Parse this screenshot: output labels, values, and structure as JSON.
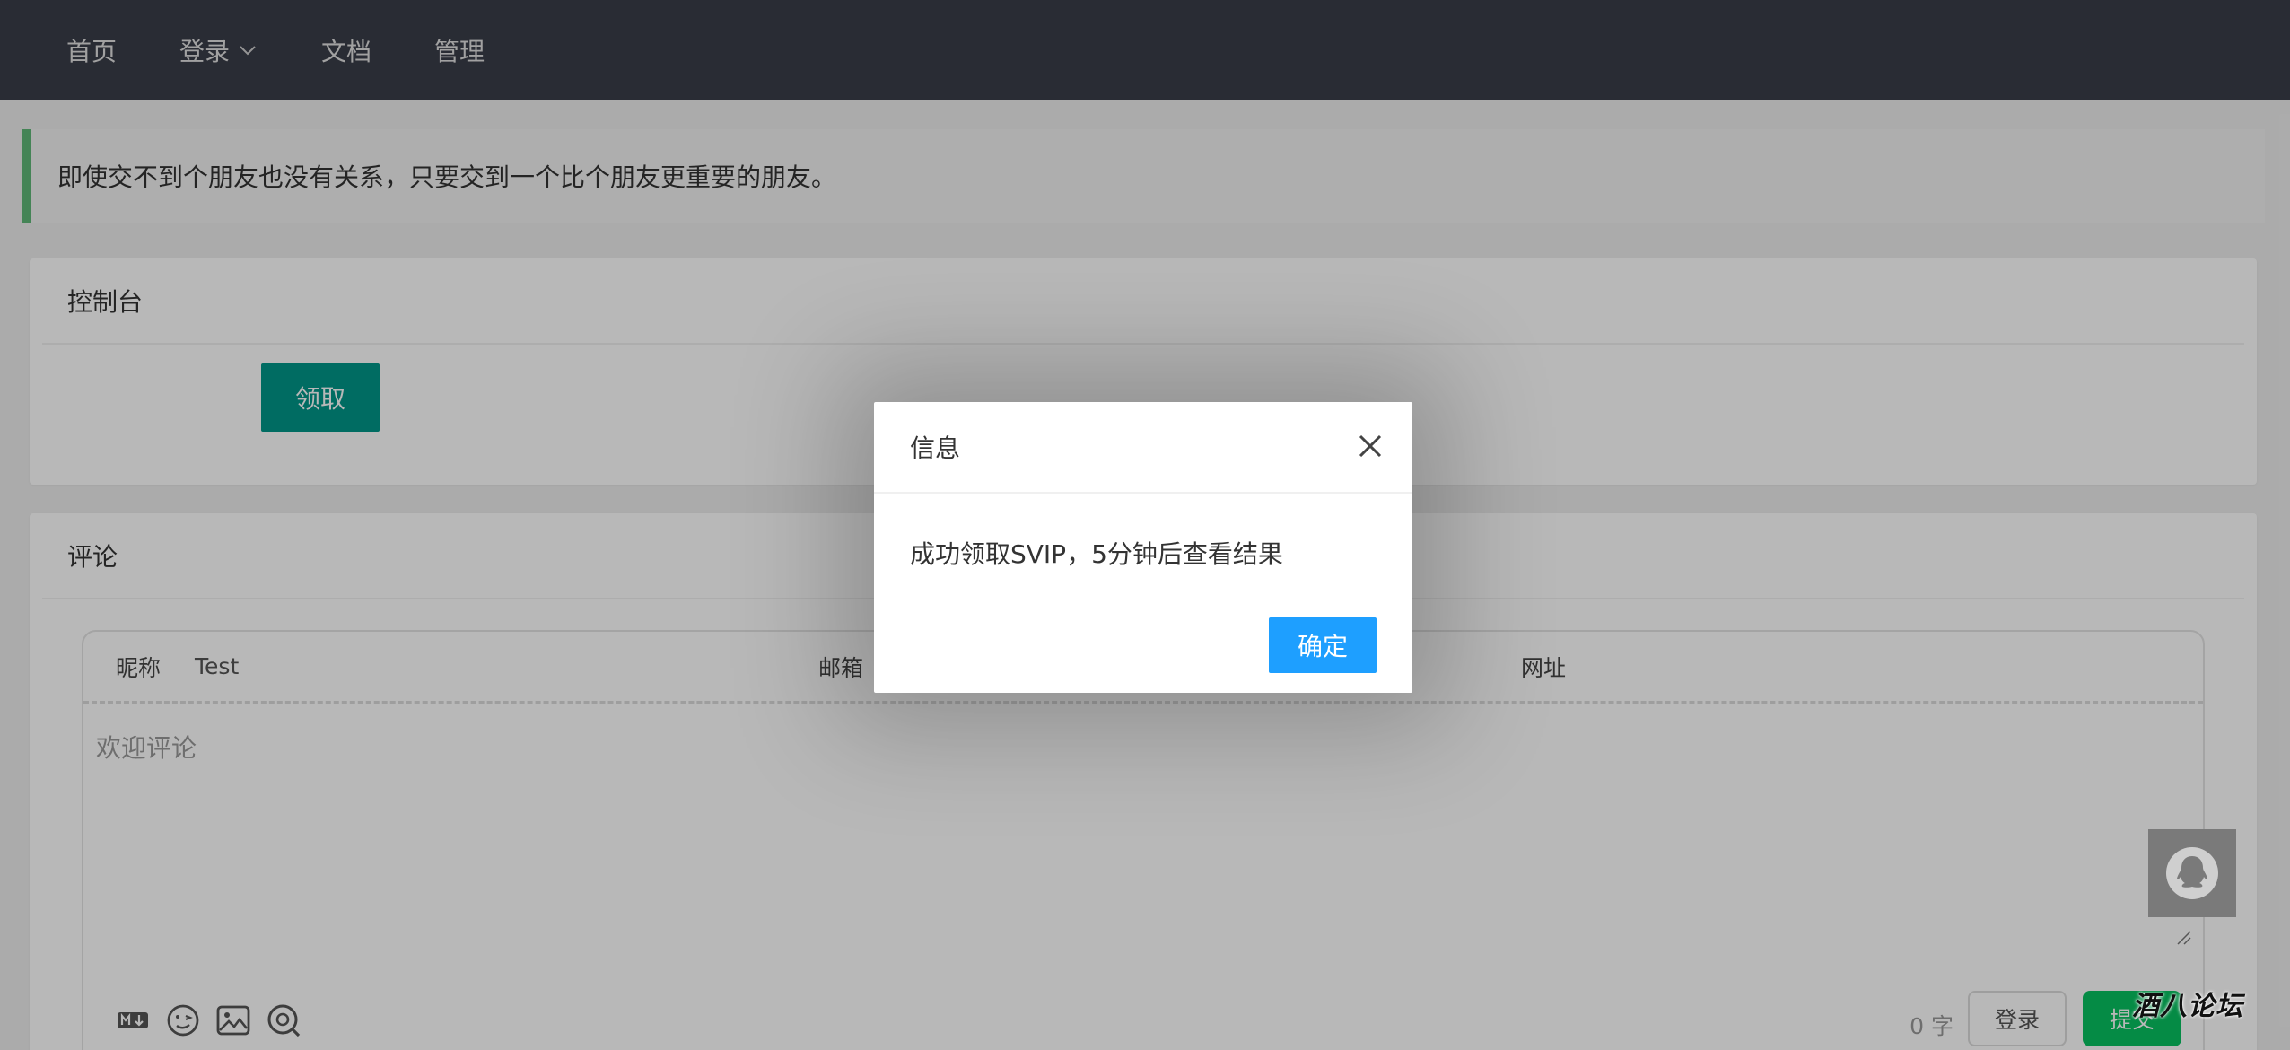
{
  "nav": {
    "items": [
      {
        "label": "首页"
      },
      {
        "label": "登录"
      },
      {
        "label": "文档"
      },
      {
        "label": "管理"
      }
    ]
  },
  "quote": {
    "text": "即使交不到个朋友也没有关系，只要交到一个比个朋友更重要的朋友。"
  },
  "console": {
    "title": "控制台",
    "claim_label": "领取"
  },
  "comment": {
    "title": "评论",
    "nickname_label": "昵称",
    "nickname_value": "Test",
    "email_label": "邮箱",
    "url_label": "网址",
    "placeholder": "欢迎评论",
    "count": "0 字",
    "login_label": "登录",
    "submit_label": "提交"
  },
  "dialog": {
    "title": "信息",
    "message": "成功领取SVIP，5分钟后查看结果",
    "ok_label": "确定"
  },
  "watermark": {
    "text": "酒八论坛"
  },
  "colors": {
    "nav_bg": "#393d49",
    "quote_accent": "#5fb878",
    "claim_btn": "#009688",
    "ok_btn": "#1e9fff",
    "submit_btn": "#07c160"
  }
}
